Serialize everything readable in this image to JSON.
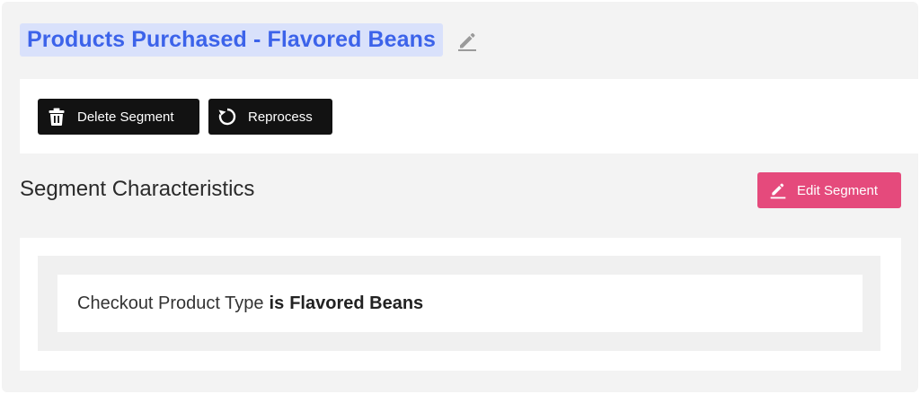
{
  "header": {
    "title": "Products Purchased - Flavored Beans",
    "edit_icon": "pencil-icon"
  },
  "actions": {
    "delete_label": "Delete Segment",
    "delete_icon": "trash-icon",
    "reprocess_label": "Reprocess",
    "reprocess_icon": "refresh-icon"
  },
  "characteristics": {
    "heading": "Segment Characteristics",
    "edit_label": "Edit Segment",
    "edit_icon": "pencil-icon",
    "rules": [
      {
        "field": "Checkout Product Type",
        "operator": "is",
        "value": "Flavored Beans"
      }
    ]
  },
  "colors": {
    "title_text": "#3c63ea",
    "title_bg": "#d9e1fb",
    "dark_button": "#121212",
    "edit_button": "#e54a7c",
    "page_bg": "#f3f3f3"
  }
}
